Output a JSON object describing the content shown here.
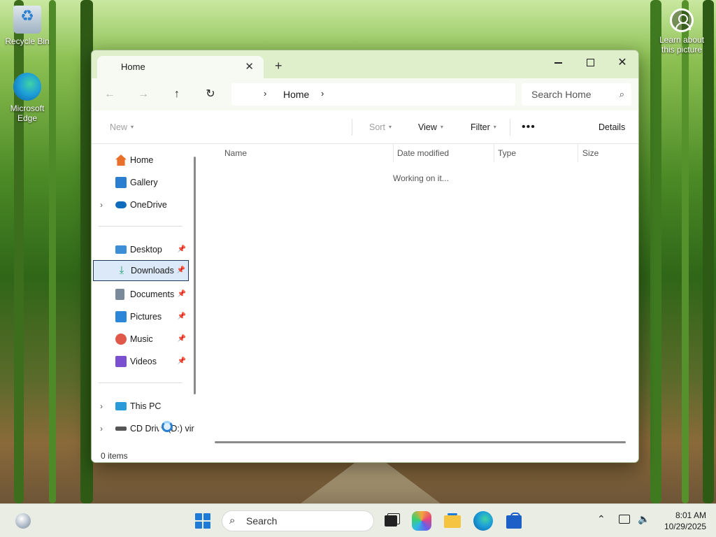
{
  "desktop": {
    "icons": [
      {
        "label": "Recycle Bin"
      },
      {
        "label": "Microsoft Edge"
      },
      {
        "label": "Learn about this picture"
      }
    ]
  },
  "window": {
    "tab_title": "Home",
    "tab_close": "✕",
    "new_tab": "+",
    "minimize_label": "Minimize",
    "maximize_label": "Maximize",
    "close_label": "✕"
  },
  "navigation": {
    "back": "←",
    "forward": "→",
    "up": "↑",
    "refresh": "↻",
    "breadcrumb": {
      "chevron": "›",
      "current": "Home"
    },
    "search_placeholder": "Search Home"
  },
  "toolbar": {
    "new": "New",
    "sort": "Sort",
    "view": "View",
    "filter": "Filter",
    "more": "•••",
    "details": "Details"
  },
  "sidebar": {
    "items": [
      {
        "label": "Home",
        "icon": "home-icon",
        "color": "#e8702a"
      },
      {
        "label": "Gallery",
        "icon": "gallery-icon",
        "color": "#2a7fd0"
      },
      {
        "label": "OneDrive",
        "icon": "cloud-icon",
        "color": "#0f6cbd"
      },
      {
        "label": "Desktop",
        "icon": "desktop-icon",
        "color": "#3c8fd6",
        "pinned": true
      },
      {
        "label": "Downloads",
        "icon": "download-icon",
        "color": "#1a9a6c",
        "pinned": true,
        "selected": true
      },
      {
        "label": "Documents",
        "icon": "document-icon",
        "color": "#7b8a9a",
        "pinned": true
      },
      {
        "label": "Pictures",
        "icon": "pictures-icon",
        "color": "#2c87d8",
        "pinned": true
      },
      {
        "label": "Music",
        "icon": "music-icon",
        "color": "#e0584a",
        "pinned": true
      },
      {
        "label": "Videos",
        "icon": "videos-icon",
        "color": "#7a4fd0",
        "pinned": true
      },
      {
        "label": "This PC",
        "icon": "pc-icon",
        "color": "#2a9bd8"
      },
      {
        "label": "CD Drive (D:) vir",
        "icon": "cd-drive-icon",
        "color": "#555555"
      }
    ]
  },
  "content": {
    "columns": [
      "Name",
      "Date modified",
      "Type",
      "Size"
    ],
    "status_message": "Working on it..."
  },
  "statusbar": {
    "text": "0 items"
  },
  "taskbar": {
    "search_label": "Search",
    "time": "8:01 AM",
    "date": "10/29/2025"
  },
  "colors": {
    "accent": "#1e7bd8",
    "selection": "#dbe9f8",
    "titlebar": "#dfeecb"
  }
}
